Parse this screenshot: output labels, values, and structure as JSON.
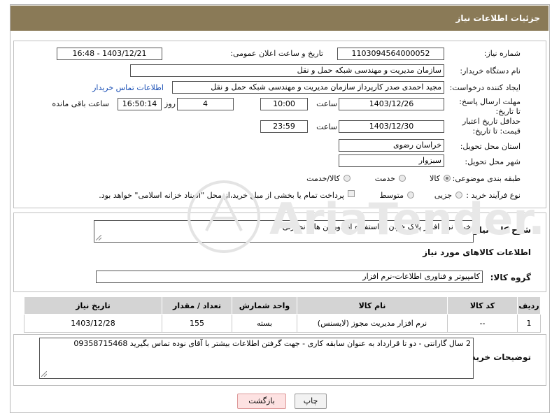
{
  "page_title": "جزئیات اطلاعات نیاز",
  "fields": {
    "need_number_label": "شماره نیاز:",
    "need_number": "1103094564000052",
    "announce_label": "تاریخ و ساعت اعلان عمومی:",
    "announce_value": "1403/12/21 - 16:48",
    "buyer_org_label": "نام دستگاه خریدار:",
    "buyer_org": "سازمان مدیریت و مهندسی شبکه حمل و نقل",
    "creator_label": "ایجاد کننده درخواست:",
    "creator": "مجید احمدی صدر کارپرداز سازمان مدیریت و مهندسی شبکه حمل و نقل",
    "contact_link": "اطلاعات تماس خریدار",
    "deadline_label": "مهلت ارسال پاسخ: تا تاریخ:",
    "deadline_date": "1403/12/26",
    "time_label": "ساعت",
    "deadline_time": "10:00",
    "days_value": "4",
    "days_label": "روز و",
    "remaining_time": "16:50:14",
    "remaining_label": "ساعت باقی مانده",
    "validity_label": "حداقل تاریخ اعتبار قیمت: تا تاریخ:",
    "validity_date": "1403/12/30",
    "validity_time": "23:59",
    "province_label": "استان محل تحویل:",
    "province": "خراسان رضوی",
    "city_label": "شهر محل تحویل:",
    "city": "سبزوار",
    "category_label": "طبقه بندی موضوعی:",
    "category_options": [
      "کالا",
      "خدمت",
      "کالا/خدمت"
    ],
    "process_label": "نوع فرآیند خرید :",
    "process_options": [
      "جزیی",
      "متوسط"
    ],
    "payment_note": "پرداخت تمام یا بخشی از مبلغ خرید،از محل \"اسناد خزانه اسلامی\" خواهد بود."
  },
  "description": {
    "label": "شرح کلی نیاز:",
    "text": "خرید نرم افزار پلاک خوان با استفاده از دوربین های نظارتی"
  },
  "goods_info": {
    "heading": "اطلاعات کالاهای مورد نیاز",
    "group_label": "گروه کالا:",
    "group_value": "کامپیوتر و فناوری اطلاعات-نرم افزار"
  },
  "table": {
    "headers": [
      "ردیف",
      "کد کالا",
      "نام کالا",
      "واحد شمارش",
      "تعداد / مقدار",
      "تاریخ نیاز"
    ],
    "rows": [
      [
        "1",
        "--",
        "نرم افزار مدیریت مجوز (لایسنس)",
        "بسته",
        "155",
        "1403/12/28"
      ]
    ]
  },
  "buyer_notes": {
    "label": "توضیحات خریدار:",
    "text": "2 سال گارانتی - دو تا قرارداد به عنوان سابقه کاری - جهت گرفتن اطلاعات بیشتر با آقای نوده تماس بگیرید 09358715468"
  },
  "buttons": {
    "print": "چاپ",
    "back": "بازگشت"
  },
  "watermark_text": "AriaTender.net"
}
